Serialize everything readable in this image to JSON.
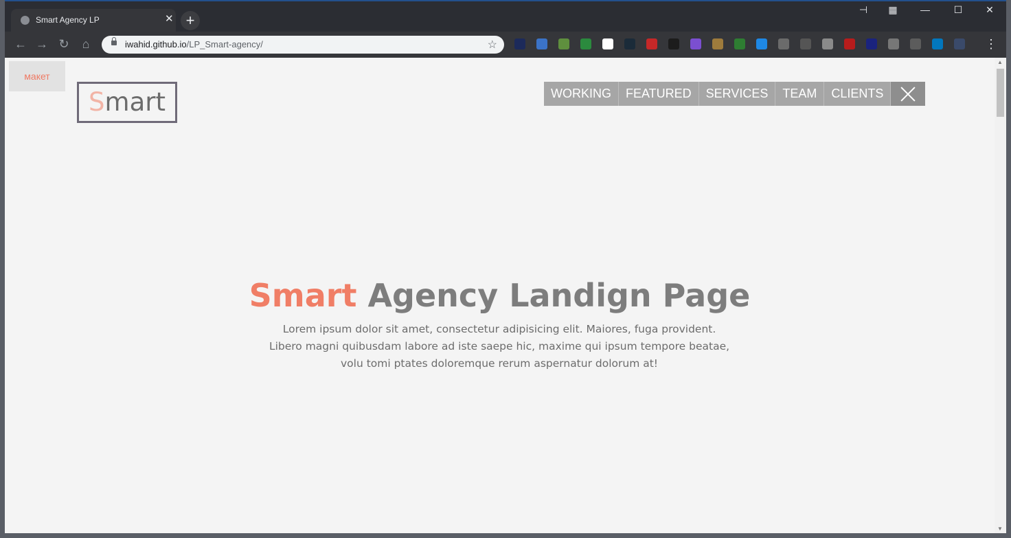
{
  "browser": {
    "tab_title": "Smart Agency LP",
    "tab_close": "✕",
    "new_tab": "+",
    "url_host": "iwahid.github.io",
    "url_path": "/LP_Smart-agency/",
    "controls": {
      "minimize": "—",
      "maximize": "☐",
      "close": "✕"
    },
    "nav": {
      "back": "←",
      "forward": "→",
      "reload": "↻",
      "home": "⌂",
      "bookmark": "☆"
    },
    "extension_colors": [
      "#1c2a5a",
      "#3b73c7",
      "#5f8f3e",
      "#2b8a3e",
      "#ffffff",
      "#1b2b39",
      "#c62828",
      "#1c1c1c",
      "#7b4fd1",
      "#9e7b3c",
      "#2e7d32",
      "#1e88e5",
      "#6b6b6b",
      "#555555",
      "#8a8a8a",
      "#b71c1c",
      "#1a237e",
      "#777777",
      "#5c5c5c",
      "#0277bd",
      "#3a4a6a"
    ],
    "menu_dots": "⋮"
  },
  "page": {
    "maket_label": "макет",
    "logo": {
      "first_letter": "S",
      "rest": "mart"
    },
    "menu": [
      "WORKING",
      "FEATURED",
      "SERVICES",
      "TEAM",
      "CLIENTS"
    ],
    "hero": {
      "title_accent": "Smart",
      "title_rest": " Agency Landign Page",
      "text": "Lorem ipsum dolor sit amet, consectetur adipisicing elit. Maiores, fuga provident. Libero magni quibusdam labore ad iste saepe hic, maxime qui ipsum tempore beatae, volu tomi ptates doloremque rerum aspernatur dolorum at!"
    }
  },
  "colors": {
    "accent": "#f07e66",
    "menu_bg": "#a6a6a6",
    "page_bg": "#f4f4f4"
  }
}
